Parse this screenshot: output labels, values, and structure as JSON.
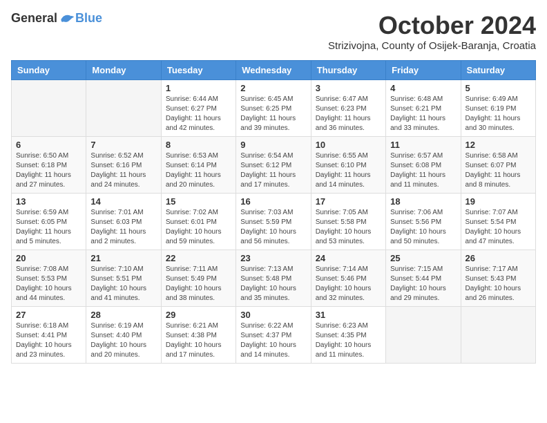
{
  "logo": {
    "general": "General",
    "blue": "Blue"
  },
  "title": "October 2024",
  "subtitle": "Strizivojna, County of Osijek-Baranja, Croatia",
  "days_of_week": [
    "Sunday",
    "Monday",
    "Tuesday",
    "Wednesday",
    "Thursday",
    "Friday",
    "Saturday"
  ],
  "weeks": [
    [
      {
        "day": null,
        "sunrise": null,
        "sunset": null,
        "daylight": null
      },
      {
        "day": null,
        "sunrise": null,
        "sunset": null,
        "daylight": null
      },
      {
        "day": "1",
        "sunrise": "Sunrise: 6:44 AM",
        "sunset": "Sunset: 6:27 PM",
        "daylight": "Daylight: 11 hours and 42 minutes."
      },
      {
        "day": "2",
        "sunrise": "Sunrise: 6:45 AM",
        "sunset": "Sunset: 6:25 PM",
        "daylight": "Daylight: 11 hours and 39 minutes."
      },
      {
        "day": "3",
        "sunrise": "Sunrise: 6:47 AM",
        "sunset": "Sunset: 6:23 PM",
        "daylight": "Daylight: 11 hours and 36 minutes."
      },
      {
        "day": "4",
        "sunrise": "Sunrise: 6:48 AM",
        "sunset": "Sunset: 6:21 PM",
        "daylight": "Daylight: 11 hours and 33 minutes."
      },
      {
        "day": "5",
        "sunrise": "Sunrise: 6:49 AM",
        "sunset": "Sunset: 6:19 PM",
        "daylight": "Daylight: 11 hours and 30 minutes."
      }
    ],
    [
      {
        "day": "6",
        "sunrise": "Sunrise: 6:50 AM",
        "sunset": "Sunset: 6:18 PM",
        "daylight": "Daylight: 11 hours and 27 minutes."
      },
      {
        "day": "7",
        "sunrise": "Sunrise: 6:52 AM",
        "sunset": "Sunset: 6:16 PM",
        "daylight": "Daylight: 11 hours and 24 minutes."
      },
      {
        "day": "8",
        "sunrise": "Sunrise: 6:53 AM",
        "sunset": "Sunset: 6:14 PM",
        "daylight": "Daylight: 11 hours and 20 minutes."
      },
      {
        "day": "9",
        "sunrise": "Sunrise: 6:54 AM",
        "sunset": "Sunset: 6:12 PM",
        "daylight": "Daylight: 11 hours and 17 minutes."
      },
      {
        "day": "10",
        "sunrise": "Sunrise: 6:55 AM",
        "sunset": "Sunset: 6:10 PM",
        "daylight": "Daylight: 11 hours and 14 minutes."
      },
      {
        "day": "11",
        "sunrise": "Sunrise: 6:57 AM",
        "sunset": "Sunset: 6:08 PM",
        "daylight": "Daylight: 11 hours and 11 minutes."
      },
      {
        "day": "12",
        "sunrise": "Sunrise: 6:58 AM",
        "sunset": "Sunset: 6:07 PM",
        "daylight": "Daylight: 11 hours and 8 minutes."
      }
    ],
    [
      {
        "day": "13",
        "sunrise": "Sunrise: 6:59 AM",
        "sunset": "Sunset: 6:05 PM",
        "daylight": "Daylight: 11 hours and 5 minutes."
      },
      {
        "day": "14",
        "sunrise": "Sunrise: 7:01 AM",
        "sunset": "Sunset: 6:03 PM",
        "daylight": "Daylight: 11 hours and 2 minutes."
      },
      {
        "day": "15",
        "sunrise": "Sunrise: 7:02 AM",
        "sunset": "Sunset: 6:01 PM",
        "daylight": "Daylight: 10 hours and 59 minutes."
      },
      {
        "day": "16",
        "sunrise": "Sunrise: 7:03 AM",
        "sunset": "Sunset: 5:59 PM",
        "daylight": "Daylight: 10 hours and 56 minutes."
      },
      {
        "day": "17",
        "sunrise": "Sunrise: 7:05 AM",
        "sunset": "Sunset: 5:58 PM",
        "daylight": "Daylight: 10 hours and 53 minutes."
      },
      {
        "day": "18",
        "sunrise": "Sunrise: 7:06 AM",
        "sunset": "Sunset: 5:56 PM",
        "daylight": "Daylight: 10 hours and 50 minutes."
      },
      {
        "day": "19",
        "sunrise": "Sunrise: 7:07 AM",
        "sunset": "Sunset: 5:54 PM",
        "daylight": "Daylight: 10 hours and 47 minutes."
      }
    ],
    [
      {
        "day": "20",
        "sunrise": "Sunrise: 7:08 AM",
        "sunset": "Sunset: 5:53 PM",
        "daylight": "Daylight: 10 hours and 44 minutes."
      },
      {
        "day": "21",
        "sunrise": "Sunrise: 7:10 AM",
        "sunset": "Sunset: 5:51 PM",
        "daylight": "Daylight: 10 hours and 41 minutes."
      },
      {
        "day": "22",
        "sunrise": "Sunrise: 7:11 AM",
        "sunset": "Sunset: 5:49 PM",
        "daylight": "Daylight: 10 hours and 38 minutes."
      },
      {
        "day": "23",
        "sunrise": "Sunrise: 7:13 AM",
        "sunset": "Sunset: 5:48 PM",
        "daylight": "Daylight: 10 hours and 35 minutes."
      },
      {
        "day": "24",
        "sunrise": "Sunrise: 7:14 AM",
        "sunset": "Sunset: 5:46 PM",
        "daylight": "Daylight: 10 hours and 32 minutes."
      },
      {
        "day": "25",
        "sunrise": "Sunrise: 7:15 AM",
        "sunset": "Sunset: 5:44 PM",
        "daylight": "Daylight: 10 hours and 29 minutes."
      },
      {
        "day": "26",
        "sunrise": "Sunrise: 7:17 AM",
        "sunset": "Sunset: 5:43 PM",
        "daylight": "Daylight: 10 hours and 26 minutes."
      }
    ],
    [
      {
        "day": "27",
        "sunrise": "Sunrise: 6:18 AM",
        "sunset": "Sunset: 4:41 PM",
        "daylight": "Daylight: 10 hours and 23 minutes."
      },
      {
        "day": "28",
        "sunrise": "Sunrise: 6:19 AM",
        "sunset": "Sunset: 4:40 PM",
        "daylight": "Daylight: 10 hours and 20 minutes."
      },
      {
        "day": "29",
        "sunrise": "Sunrise: 6:21 AM",
        "sunset": "Sunset: 4:38 PM",
        "daylight": "Daylight: 10 hours and 17 minutes."
      },
      {
        "day": "30",
        "sunrise": "Sunrise: 6:22 AM",
        "sunset": "Sunset: 4:37 PM",
        "daylight": "Daylight: 10 hours and 14 minutes."
      },
      {
        "day": "31",
        "sunrise": "Sunrise: 6:23 AM",
        "sunset": "Sunset: 4:35 PM",
        "daylight": "Daylight: 10 hours and 11 minutes."
      },
      {
        "day": null,
        "sunrise": null,
        "sunset": null,
        "daylight": null
      },
      {
        "day": null,
        "sunrise": null,
        "sunset": null,
        "daylight": null
      }
    ]
  ]
}
